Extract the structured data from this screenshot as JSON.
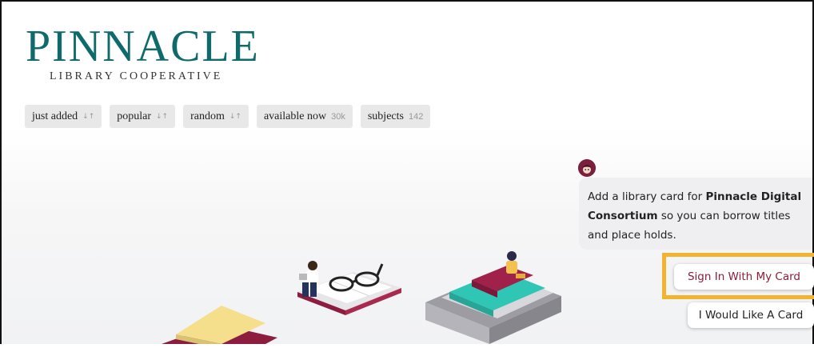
{
  "logo": {
    "title": "PINNACLE",
    "subtitle": "LIBRARY COOPERATIVE"
  },
  "tabs": [
    {
      "label": "just added",
      "icon": "sort-icon",
      "count": ""
    },
    {
      "label": "popular",
      "icon": "sort-icon",
      "count": ""
    },
    {
      "label": "random",
      "icon": "sort-icon",
      "count": ""
    },
    {
      "label": "available now",
      "icon": "",
      "count": "30k"
    },
    {
      "label": "subjects",
      "icon": "",
      "count": "142"
    }
  ],
  "sort_glyph": "↓↑",
  "prompt": {
    "text_before": "Add a library card for ",
    "library_name": "Pinnacle Digital Consortium",
    "text_after": " so you can borrow titles and place holds."
  },
  "buttons": {
    "sign_in": "Sign In With My Card",
    "request_card": "I Would Like A Card"
  },
  "colors": {
    "brand": "#0f6a6c",
    "accent": "#8a1c3c",
    "highlight": "#f2b32e"
  }
}
